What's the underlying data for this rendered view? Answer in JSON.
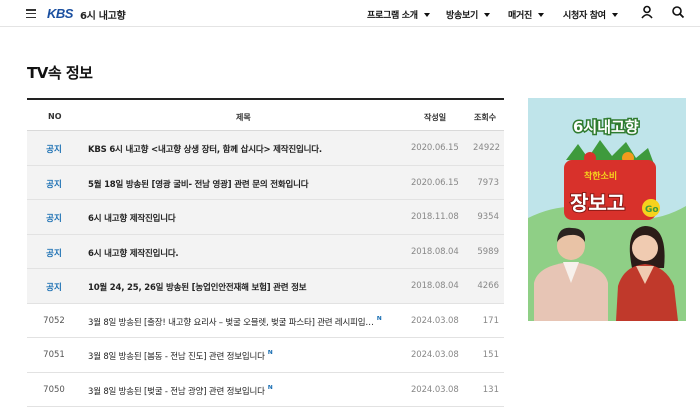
{
  "header": {
    "logo": "KBS",
    "program_name": "6시 내고향",
    "nav": [
      {
        "label": "프로그램 소개"
      },
      {
        "label": "방송보기"
      },
      {
        "label": "매거진"
      },
      {
        "label": "시청자 참여"
      }
    ],
    "icons": [
      "hamburger-icon",
      "user-icon",
      "search-icon"
    ]
  },
  "page": {
    "title": "TV속 정보"
  },
  "table": {
    "columns": {
      "no": "NO",
      "title": "제목",
      "date": "작성일",
      "views": "조회수"
    },
    "rows": [
      {
        "no": "공지",
        "title": "KBS 6시 내고향 <내고향 상생 장터, 함께 삽시다> 제작진입니다.",
        "date": "2020.06.15",
        "views": "24922",
        "notice": true
      },
      {
        "no": "공지",
        "title": "5월 18일 방송된 [영광 굴비- 전남 영광] 관련 문의 전화입니다",
        "date": "2020.06.15",
        "views": "7973",
        "notice": true
      },
      {
        "no": "공지",
        "title": "6시 내고향 제작진입니다",
        "date": "2018.11.08",
        "views": "9354",
        "notice": true
      },
      {
        "no": "공지",
        "title": "6시 내고향 제작진입니다.",
        "date": "2018.08.04",
        "views": "5989",
        "notice": true
      },
      {
        "no": "공지",
        "title": "10월 24, 25, 26일 방송된 [농업인안전재해 보험] 관련 정보",
        "date": "2018.08.04",
        "views": "4266",
        "notice": true
      },
      {
        "no": "7052",
        "title": "3월 8일 방송된 [출장! 내고향 요리사 – 벚굴 오믈렛, 벚굴 파스타] 관련 레시피입…",
        "date": "2024.03.08",
        "views": "171",
        "notice": false,
        "new": "N"
      },
      {
        "no": "7051",
        "title": "3월 8일 방송된 [봄동 - 전남 진도] 관련 정보입니다",
        "date": "2024.03.08",
        "views": "151",
        "notice": false,
        "new": "N"
      },
      {
        "no": "7050",
        "title": "3월 8일 방송된 [벚굴 - 전남 광양] 관련 정보입니다",
        "date": "2024.03.08",
        "views": "131",
        "notice": false,
        "new": "N"
      }
    ]
  },
  "banner": {
    "logo_text": "6시내고향",
    "headline_small": "착한소비",
    "headline_big": "장보고",
    "headline_tag": "Go",
    "colors": {
      "sky": "#bfe4ea",
      "red": "#d8312b",
      "green": "#3e9a3c",
      "yellow": "#f6d21d"
    }
  },
  "colors": {
    "accent_blue": "#1a6fb3",
    "logo_blue": "#1a4fa0"
  }
}
